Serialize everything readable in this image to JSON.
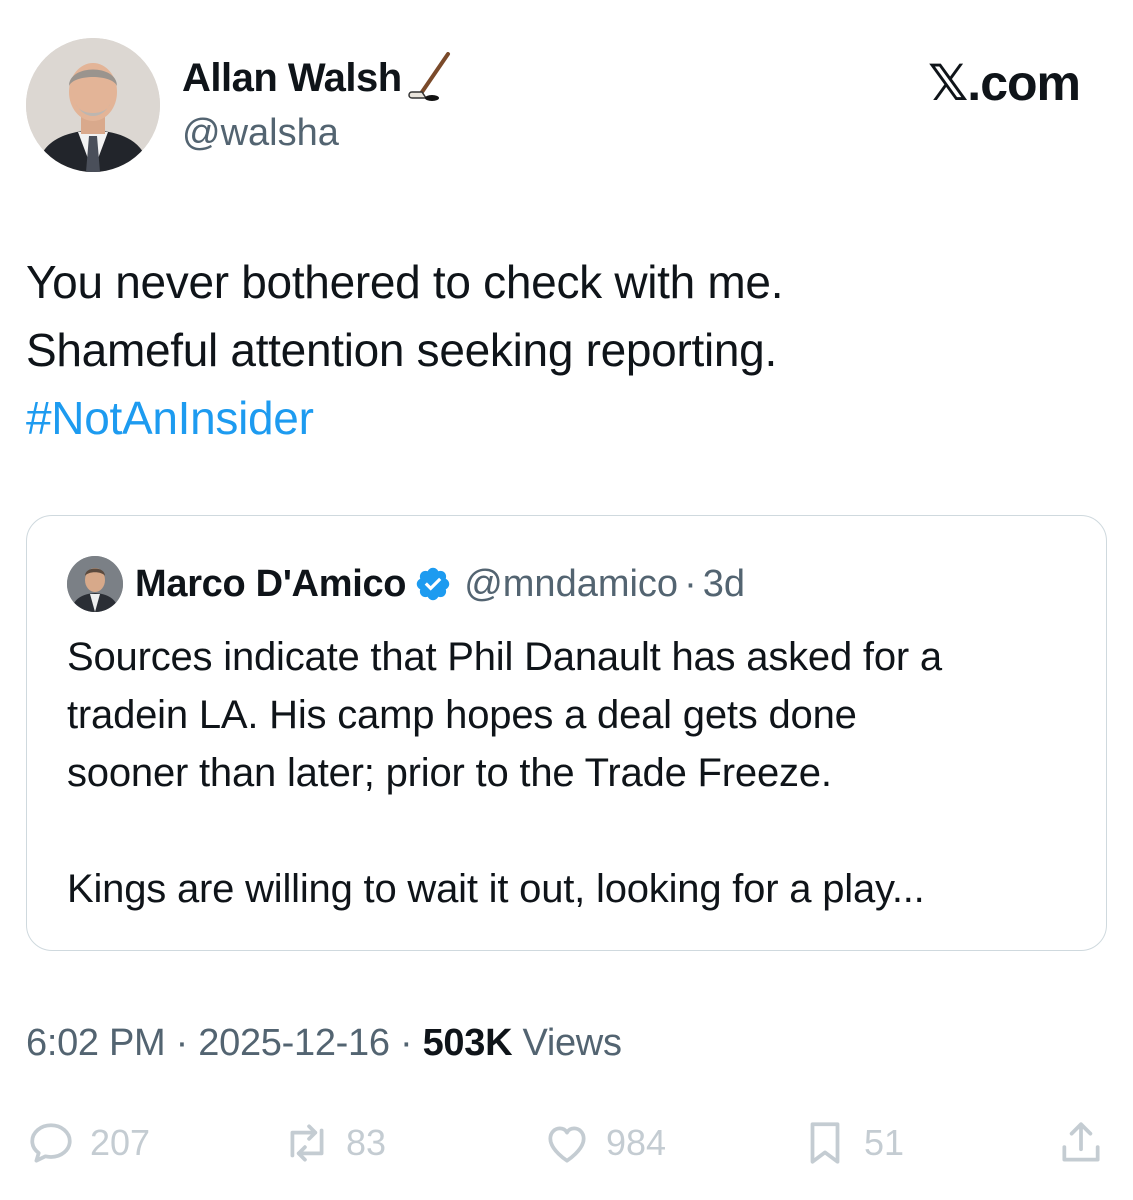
{
  "author": {
    "name": "Allan Walsh",
    "handle": "@walsha",
    "emoji_icon": "hockey-stick-icon"
  },
  "brand": "𝕏.com",
  "tweet": {
    "lines": [
      "You never bothered to check with me.",
      "Shameful attention seeking reporting."
    ],
    "hashtag": "#NotAnInsider"
  },
  "quoted": {
    "name": "Marco D'Amico",
    "handle": "@mndamico",
    "separator": "·",
    "time": "3d",
    "verified_color": "#1d9bf0",
    "lines": [
      "Sources indicate that Phil Danault has asked for a",
      "tradein LA. His camp hopes a deal gets done",
      "sooner than later; prior to the Trade Freeze."
    ],
    "lines2": [
      "Kings are willing to wait it out, looking for a play..."
    ]
  },
  "meta": {
    "time": "6:02 PM",
    "sep1": " · ",
    "date": "2025-12-16",
    "sep2": " · ",
    "views_count": "503K",
    "views_label": " Views"
  },
  "actions": {
    "replies": "207",
    "reposts": "83",
    "likes": "984",
    "bookmarks": "51"
  },
  "colors": {
    "link": "#1d9bf0",
    "secondary_text": "#536471",
    "border": "#cfd9de",
    "action_icons": "#c4ccd2"
  }
}
